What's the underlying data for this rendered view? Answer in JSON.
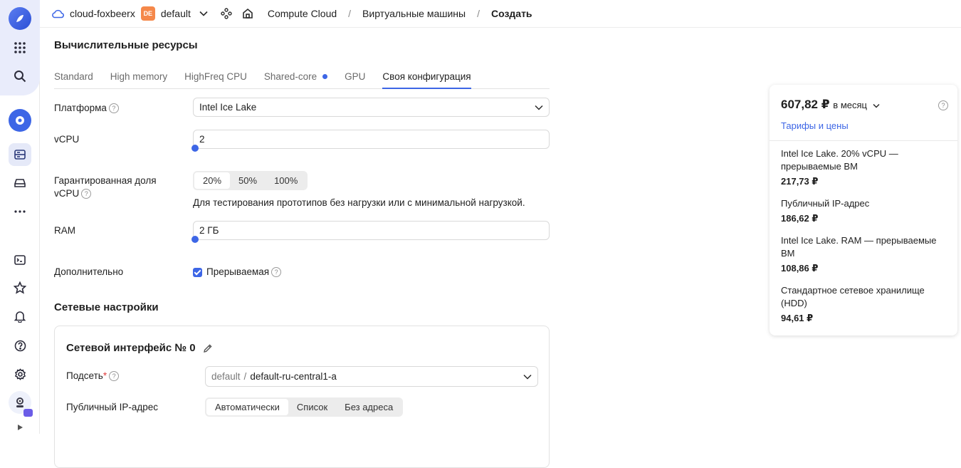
{
  "header": {
    "cloud": "cloud-foxbeerx",
    "folder_badge": "DE",
    "folder": "default",
    "crumbs": [
      "Compute Cloud",
      "Виртуальные машины",
      "Создать"
    ]
  },
  "main": {
    "title": "Вычислительные ресурсы",
    "tabs": [
      "Standard",
      "High memory",
      "HighFreq CPU",
      "Shared-core",
      "GPU",
      "Своя конфигурация"
    ],
    "platform_label": "Платформа",
    "platform_value": "Intel Ice Lake",
    "vcpu_label": "vCPU",
    "vcpu_value": "2",
    "share_label_1": "Гарантированная доля",
    "share_label_2": "vCPU",
    "share_options": [
      "20%",
      "50%",
      "100%"
    ],
    "share_hint": "Для тестирования прототипов без нагрузки или с минимальной нагрузкой.",
    "ram_label": "RAM",
    "ram_value": "2 ГБ",
    "extra_label": "Дополнительно",
    "preemptible_label": "Прерываемая",
    "network_title": "Сетевые настройки",
    "iface_title": "Сетевой интерфейс № 0",
    "subnet_label": "Подсеть",
    "subnet_folder": "default",
    "subnet_sep": "/",
    "subnet_value": "default-ru-central1-a",
    "public_ip_label": "Публичный IP-адрес",
    "ip_options": [
      "Автоматически",
      "Список",
      "Без адреса"
    ]
  },
  "price": {
    "total": "607,82 ₽",
    "period": "в месяц",
    "link": "Тарифы и цены",
    "items": [
      {
        "name": "Intel Ice Lake. 20% vCPU — прерываемые ВМ",
        "amount": "217,73 ₽"
      },
      {
        "name": "Публичный IP-адрес",
        "amount": "186,62 ₽"
      },
      {
        "name": "Intel Ice Lake. RAM — прерываемые ВМ",
        "amount": "108,86 ₽"
      },
      {
        "name": "Стандартное сетевое хранилище (HDD)",
        "amount": "94,61 ₽"
      }
    ]
  },
  "colors": {
    "accent": "#3d66e6",
    "badge": "#f5884a"
  }
}
